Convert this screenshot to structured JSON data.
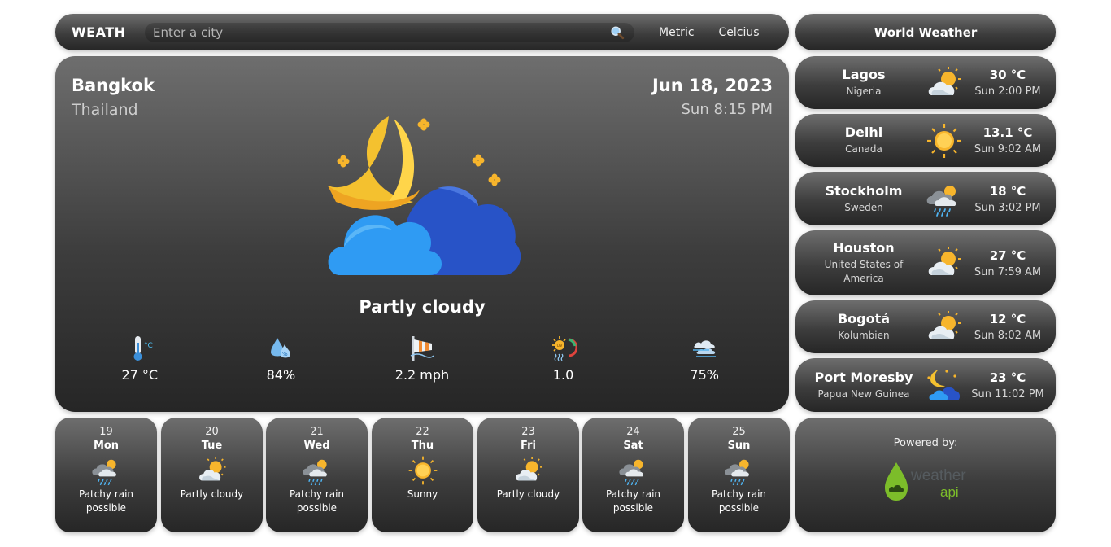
{
  "header": {
    "brand": "WEATH",
    "search_placeholder": "Enter a city",
    "search_icon": "magnifier-icon",
    "units_label": "Metric",
    "temp_label": "Celcius"
  },
  "world": {
    "title": "World Weather",
    "cities": [
      {
        "name": "Lagos",
        "country": "Nigeria",
        "icon": "partly-cloudy-sun",
        "temp": "30 °C",
        "time": "Sun 2:00 PM"
      },
      {
        "name": "Delhi",
        "country": "Canada",
        "icon": "sunny",
        "temp": "13.1 °C",
        "time": "Sun 9:02 AM"
      },
      {
        "name": "Stockholm",
        "country": "Sweden",
        "icon": "patchy-rain",
        "temp": "18 °C",
        "time": "Sun 3:02 PM"
      },
      {
        "name": "Houston",
        "country": "United States of America",
        "icon": "partly-cloudy-sun",
        "temp": "27 °C",
        "time": "Sun 7:59 AM"
      },
      {
        "name": "Bogotá",
        "country": "Kolumbien",
        "icon": "partly-cloudy-sun",
        "temp": "12 °C",
        "time": "Sun 8:02 AM"
      },
      {
        "name": "Port Moresby",
        "country": "Papua New Guinea",
        "icon": "partly-cloudy-night",
        "temp": "23 °C",
        "time": "Sun 11:02 PM"
      }
    ]
  },
  "current": {
    "city": "Bangkok",
    "country": "Thailand",
    "date": "Jun 18, 2023",
    "time": "Sun 8:15 PM",
    "icon": "partly-cloudy-night",
    "condition": "Partly cloudy",
    "stats": [
      {
        "icon": "thermometer-icon",
        "value": "27 °C"
      },
      {
        "icon": "humidity-icon",
        "value": "84%"
      },
      {
        "icon": "wind-sock-icon",
        "value": "2.2 mph"
      },
      {
        "icon": "uv-index-icon",
        "value": "1.0"
      },
      {
        "icon": "cloud-cover-icon",
        "value": "75%"
      }
    ]
  },
  "forecast": [
    {
      "num": "19",
      "day": "Mon",
      "icon": "patchy-rain",
      "cond": "Patchy rain possible"
    },
    {
      "num": "20",
      "day": "Tue",
      "icon": "partly-cloudy-sun",
      "cond": "Partly cloudy"
    },
    {
      "num": "21",
      "day": "Wed",
      "icon": "patchy-rain",
      "cond": "Patchy rain possible"
    },
    {
      "num": "22",
      "day": "Thu",
      "icon": "sunny",
      "cond": "Sunny"
    },
    {
      "num": "23",
      "day": "Fri",
      "icon": "partly-cloudy-sun",
      "cond": "Partly cloudy"
    },
    {
      "num": "24",
      "day": "Sat",
      "icon": "patchy-rain",
      "cond": "Patchy rain possible"
    },
    {
      "num": "25",
      "day": "Sun",
      "icon": "patchy-rain",
      "cond": "Patchy rain possible"
    }
  ],
  "powered": {
    "label": "Powered by:",
    "logo_word1": "weather",
    "logo_word2": "api"
  },
  "colors": {
    "moon": "#f6c431",
    "cloud_front": "#2f9bf3",
    "cloud_back": "#2853c7",
    "sun": "#f7b52c",
    "logo_green": "#7cbd2a"
  }
}
